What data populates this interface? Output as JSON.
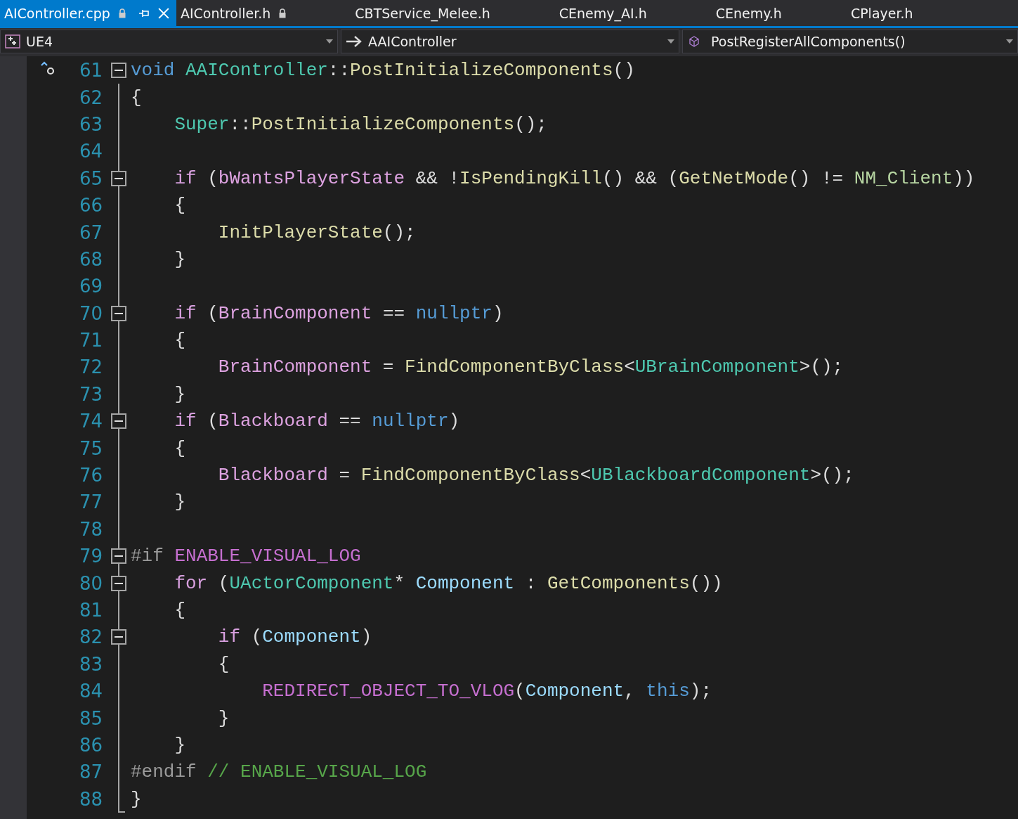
{
  "tabs": [
    {
      "label": "AIController.cpp",
      "selected": true,
      "locked": true,
      "pinnable": true
    },
    {
      "label": "AIController.h",
      "selected": false,
      "locked": true,
      "pinnable": false
    },
    {
      "label": "CBTService_Melee.h",
      "selected": false,
      "locked": false,
      "pinnable": false
    },
    {
      "label": "CEnemy_AI.h",
      "selected": false,
      "locked": false,
      "pinnable": false
    },
    {
      "label": "CEnemy.h",
      "selected": false,
      "locked": false,
      "pinnable": false
    },
    {
      "label": "CPlayer.h",
      "selected": false,
      "locked": false,
      "pinnable": false
    }
  ],
  "nav_bar": {
    "project": "UE4",
    "scope": "AAIController",
    "member": "PostRegisterAllComponents()"
  },
  "lines": [
    {
      "number": "61",
      "fold": true,
      "glyph": true,
      "tokens": [
        {
          "kind": "kw",
          "t": "void "
        },
        {
          "kind": "type",
          "t": "AAIController"
        },
        {
          "kind": "plain",
          "t": "::"
        },
        {
          "kind": "func",
          "t": "PostInitializeComponents"
        },
        {
          "kind": "plain",
          "t": "()"
        }
      ]
    },
    {
      "number": "62",
      "fold": false,
      "glyph": false,
      "tokens": [
        {
          "kind": "plain",
          "t": "{"
        }
      ]
    },
    {
      "number": "63",
      "fold": false,
      "glyph": false,
      "tokens": [
        {
          "kind": "type",
          "t": "    Super"
        },
        {
          "kind": "plain",
          "t": "::"
        },
        {
          "kind": "func",
          "t": "PostInitializeComponents"
        },
        {
          "kind": "plain",
          "t": "();"
        }
      ]
    },
    {
      "number": "64",
      "fold": false,
      "glyph": false
    },
    {
      "number": "65",
      "fold": true,
      "glyph": false,
      "tokens": [
        {
          "kind": "ctl",
          "t": "    if"
        },
        {
          "kind": "plain",
          "t": " ("
        },
        {
          "kind": "mem",
          "t": "bWantsPlayerState"
        },
        {
          "kind": "plain",
          "t": " && !"
        },
        {
          "kind": "func",
          "t": "IsPendingKill"
        },
        {
          "kind": "plain",
          "t": "() && ("
        },
        {
          "kind": "func",
          "t": "GetNetMode"
        },
        {
          "kind": "plain",
          "t": "() != "
        },
        {
          "kind": "enum",
          "t": "NM_Client"
        },
        {
          "kind": "plain",
          "t": "))"
        }
      ]
    },
    {
      "number": "66",
      "fold": false,
      "glyph": false,
      "tokens": [
        {
          "kind": "plain",
          "t": "    {"
        }
      ]
    },
    {
      "number": "67",
      "fold": false,
      "glyph": false,
      "tokens": [
        {
          "kind": "func",
          "t": "        InitPlayerState"
        },
        {
          "kind": "plain",
          "t": "();"
        }
      ]
    },
    {
      "number": "68",
      "fold": false,
      "glyph": false,
      "tokens": [
        {
          "kind": "plain",
          "t": "    }"
        }
      ]
    },
    {
      "number": "69",
      "fold": false,
      "glyph": false
    },
    {
      "number": "70",
      "fold": true,
      "glyph": false,
      "tokens": [
        {
          "kind": "ctl",
          "t": "    if"
        },
        {
          "kind": "plain",
          "t": " ("
        },
        {
          "kind": "mem",
          "t": "BrainComponent"
        },
        {
          "kind": "plain",
          "t": " == "
        },
        {
          "kind": "kw",
          "t": "nullptr"
        },
        {
          "kind": "plain",
          "t": ")"
        }
      ]
    },
    {
      "number": "71",
      "fold": false,
      "glyph": false,
      "tokens": [
        {
          "kind": "plain",
          "t": "    {"
        }
      ]
    },
    {
      "number": "72",
      "fold": false,
      "glyph": false,
      "tokens": [
        {
          "kind": "mem",
          "t": "        BrainComponent"
        },
        {
          "kind": "plain",
          "t": " = "
        },
        {
          "kind": "func",
          "t": "FindComponentByClass"
        },
        {
          "kind": "plain",
          "t": "<"
        },
        {
          "kind": "type",
          "t": "UBrainComponent"
        },
        {
          "kind": "plain",
          "t": ">();"
        }
      ]
    },
    {
      "number": "73",
      "fold": false,
      "glyph": false,
      "tokens": [
        {
          "kind": "plain",
          "t": "    }"
        }
      ]
    },
    {
      "number": "74",
      "fold": true,
      "glyph": false,
      "tokens": [
        {
          "kind": "ctl",
          "t": "    if"
        },
        {
          "kind": "plain",
          "t": " ("
        },
        {
          "kind": "mem",
          "t": "Blackboard"
        },
        {
          "kind": "plain",
          "t": " == "
        },
        {
          "kind": "kw",
          "t": "nullptr"
        },
        {
          "kind": "plain",
          "t": ")"
        }
      ]
    },
    {
      "number": "75",
      "fold": false,
      "glyph": false,
      "tokens": [
        {
          "kind": "plain",
          "t": "    {"
        }
      ]
    },
    {
      "number": "76",
      "fold": false,
      "glyph": false,
      "tokens": [
        {
          "kind": "mem",
          "t": "        Blackboard"
        },
        {
          "kind": "plain",
          "t": " = "
        },
        {
          "kind": "func",
          "t": "FindComponentByClass"
        },
        {
          "kind": "plain",
          "t": "<"
        },
        {
          "kind": "type",
          "t": "UBlackboardComponent"
        },
        {
          "kind": "plain",
          "t": ">();"
        }
      ]
    },
    {
      "number": "77",
      "fold": false,
      "glyph": false,
      "tokens": [
        {
          "kind": "plain",
          "t": "    }"
        }
      ]
    },
    {
      "number": "78",
      "fold": false,
      "glyph": false
    },
    {
      "number": "79",
      "fold": true,
      "glyph": false,
      "tokens": [
        {
          "kind": "pre",
          "t": "#if "
        },
        {
          "kind": "macro",
          "t": "ENABLE_VISUAL_LOG"
        }
      ]
    },
    {
      "number": "80",
      "fold": true,
      "glyph": false,
      "tokens": [
        {
          "kind": "ctl",
          "t": "    for"
        },
        {
          "kind": "plain",
          "t": " ("
        },
        {
          "kind": "type",
          "t": "UActorComponent"
        },
        {
          "kind": "plain",
          "t": "* "
        },
        {
          "kind": "local",
          "t": "Component"
        },
        {
          "kind": "plain",
          "t": " : "
        },
        {
          "kind": "func",
          "t": "GetComponents"
        },
        {
          "kind": "plain",
          "t": "())"
        }
      ]
    },
    {
      "number": "81",
      "fold": false,
      "glyph": false,
      "tokens": [
        {
          "kind": "plain",
          "t": "    {"
        }
      ]
    },
    {
      "number": "82",
      "fold": true,
      "glyph": false,
      "tokens": [
        {
          "kind": "ctl",
          "t": "        if"
        },
        {
          "kind": "plain",
          "t": " ("
        },
        {
          "kind": "local",
          "t": "Component"
        },
        {
          "kind": "plain",
          "t": ")"
        }
      ]
    },
    {
      "number": "83",
      "fold": false,
      "glyph": false,
      "tokens": [
        {
          "kind": "plain",
          "t": "        {"
        }
      ]
    },
    {
      "number": "84",
      "fold": false,
      "glyph": false,
      "tokens": [
        {
          "kind": "macro",
          "t": "            REDIRECT_OBJECT_TO_VLOG"
        },
        {
          "kind": "plain",
          "t": "("
        },
        {
          "kind": "local",
          "t": "Component"
        },
        {
          "kind": "plain",
          "t": ", "
        },
        {
          "kind": "kw",
          "t": "this"
        },
        {
          "kind": "plain",
          "t": ");"
        }
      ]
    },
    {
      "number": "85",
      "fold": false,
      "glyph": false,
      "tokens": [
        {
          "kind": "plain",
          "t": "        }"
        }
      ]
    },
    {
      "number": "86",
      "fold": false,
      "glyph": false,
      "tokens": [
        {
          "kind": "plain",
          "t": "    }"
        }
      ]
    },
    {
      "number": "87",
      "fold": false,
      "glyph": false,
      "tokens": [
        {
          "kind": "pre",
          "t": "#endif "
        },
        {
          "kind": "comment",
          "t": "// ENABLE_VISUAL_LOG"
        }
      ]
    },
    {
      "number": "88",
      "fold": false,
      "glyph": false,
      "tokens": [
        {
          "kind": "plain",
          "t": "}"
        }
      ]
    }
  ]
}
